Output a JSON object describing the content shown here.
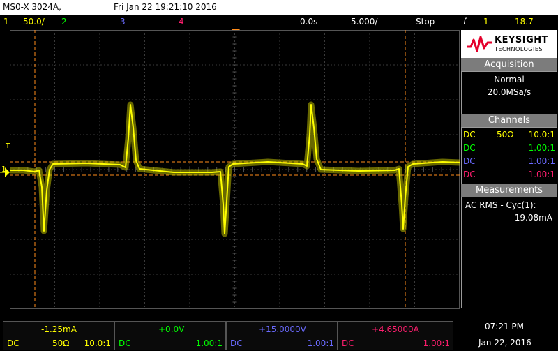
{
  "header": {
    "model": "MS0-X 3024A,",
    "datetime": "Fri Jan 22 19:21:10 2016"
  },
  "status": {
    "ch1": "1",
    "ch1_scale": "50.0/",
    "ch2": "2",
    "ch3": "3",
    "ch4": "4",
    "time_offset": "0.0s",
    "time_scale": "5.000/",
    "run_state": "Stop",
    "trigger_symbol": "f",
    "trigger_channel": "1",
    "trigger_level": "18.7"
  },
  "brand": {
    "name": "KEYSIGHT",
    "sub": "TECHNOLOGIES",
    "logo_color": "#e4002b"
  },
  "acquisition": {
    "title": "Acquisition",
    "mode": "Normal",
    "rate": "20.0MSa/s"
  },
  "channels": {
    "title": "Channels",
    "rows": [
      {
        "coupling": "DC",
        "impedance": "50Ω",
        "probe": "10.0:1",
        "color": "#ffff00"
      },
      {
        "coupling": "DC",
        "impedance": "",
        "probe": "1.00:1",
        "color": "#00ff00"
      },
      {
        "coupling": "DC",
        "impedance": "",
        "probe": "1.00:1",
        "color": "#6a6aff"
      },
      {
        "coupling": "DC",
        "impedance": "",
        "probe": "1.00:1",
        "color": "#ff1e6e"
      }
    ]
  },
  "measurements": {
    "title": "Measurements",
    "label": "AC RMS - Cyc(1):",
    "value": "19.08mA"
  },
  "bottom": {
    "channels": [
      {
        "value": "-1.25mA",
        "coupling": "DC",
        "impedance": "50Ω",
        "probe": "10.0:1",
        "color": "#ffff00"
      },
      {
        "value": "+0.0V",
        "coupling": "DC",
        "impedance": "",
        "probe": "1.00:1",
        "color": "#00ff00"
      },
      {
        "value": "+15.0000V",
        "coupling": "DC",
        "impedance": "",
        "probe": "1.00:1",
        "color": "#6a6aff"
      },
      {
        "value": "+4.65000A",
        "coupling": "DC",
        "impedance": "",
        "probe": "1.00:1",
        "color": "#ff1e6e"
      }
    ],
    "time": "07:21 PM",
    "date": "Jan 22, 2016"
  },
  "markers": {
    "trigger_T": "T",
    "ground_1": "1"
  },
  "colors": {
    "ch1": "#ffff00",
    "ch2": "#00ff00",
    "ch3": "#6a6aff",
    "ch4": "#ff1e6e",
    "cursor": "#ff8c1a"
  }
}
